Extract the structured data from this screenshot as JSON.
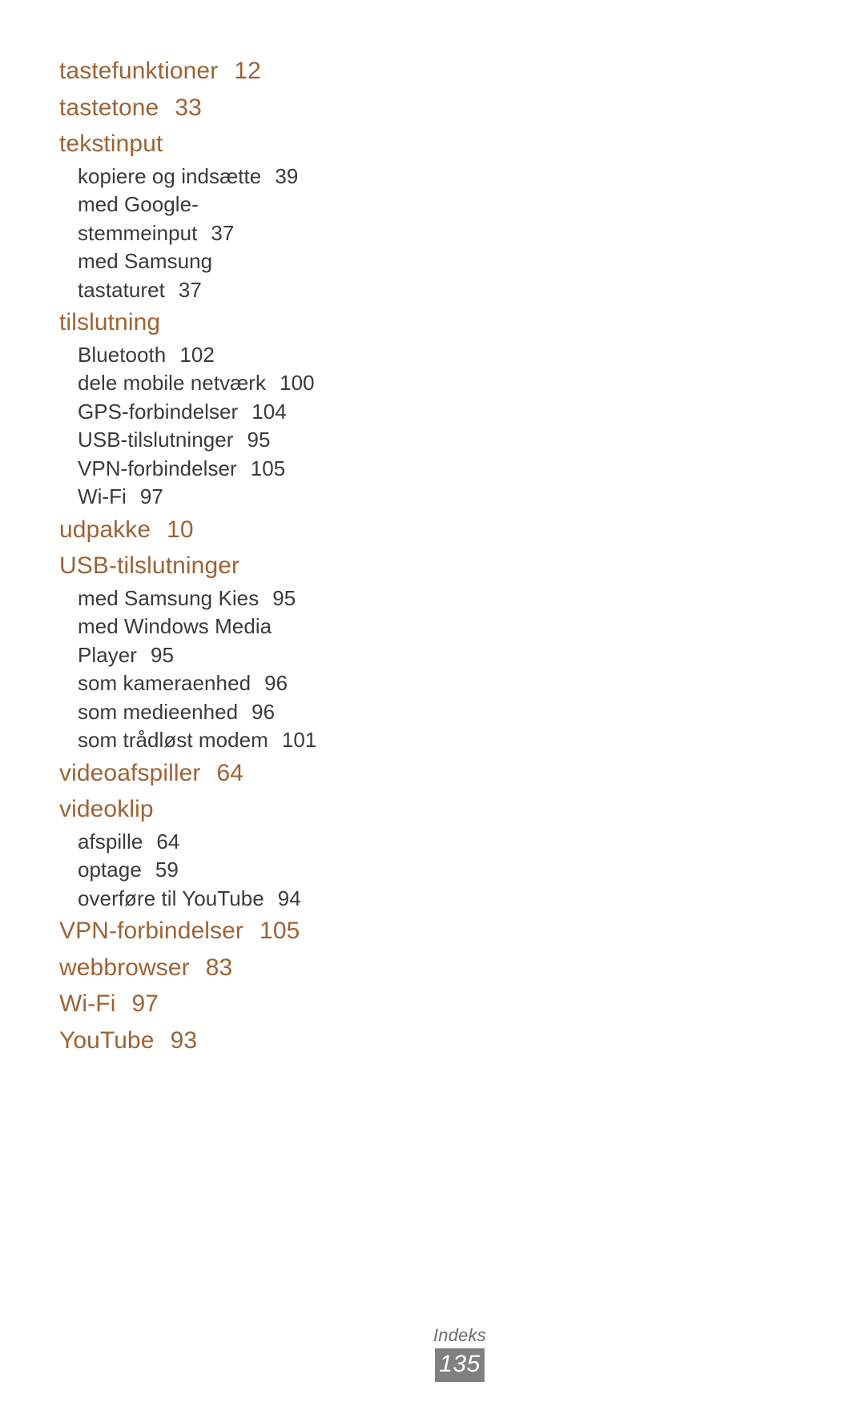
{
  "document": {
    "type": "index-page",
    "language": "da"
  },
  "colors": {
    "heading": "#9D6336",
    "subentry": "#3A3A3A",
    "footer_label": "#6B6B6B",
    "footer_pageno_background": "#808080",
    "footer_pageno_text": "#FFFFFF",
    "page_background": "#FFFFFF"
  },
  "index": {
    "entries": [
      {
        "label": "tastefunktioner",
        "page": "12",
        "subentries": []
      },
      {
        "label": "tastetone",
        "page": "33",
        "subentries": []
      },
      {
        "label": "tekstinput",
        "page": "",
        "subentries": [
          {
            "lines": [
              "kopiere og indsætte"
            ],
            "page": "39"
          },
          {
            "lines": [
              "med Google-",
              "stemmeinput"
            ],
            "page": "37"
          },
          {
            "lines": [
              "med Samsung",
              "tastaturet"
            ],
            "page": "37"
          }
        ]
      },
      {
        "label": "tilslutning",
        "page": "",
        "subentries": [
          {
            "lines": [
              "Bluetooth"
            ],
            "page": "102"
          },
          {
            "lines": [
              "dele mobile netværk"
            ],
            "page": "100"
          },
          {
            "lines": [
              "GPS-forbindelser"
            ],
            "page": "104"
          },
          {
            "lines": [
              "USB-tilslutninger"
            ],
            "page": "95"
          },
          {
            "lines": [
              "VPN-forbindelser"
            ],
            "page": "105"
          },
          {
            "lines": [
              "Wi-Fi"
            ],
            "page": "97"
          }
        ]
      },
      {
        "label": "udpakke",
        "page": "10",
        "subentries": []
      },
      {
        "label": "USB-tilslutninger",
        "page": "",
        "subentries": [
          {
            "lines": [
              "med Samsung Kies"
            ],
            "page": "95"
          },
          {
            "lines": [
              "med Windows Media",
              "Player"
            ],
            "page": "95"
          },
          {
            "lines": [
              "som kameraenhed"
            ],
            "page": "96"
          },
          {
            "lines": [
              "som medieenhed"
            ],
            "page": "96"
          },
          {
            "lines": [
              "som trådløst modem"
            ],
            "page": "101"
          }
        ]
      },
      {
        "label": "videoafspiller",
        "page": "64",
        "subentries": []
      },
      {
        "label": "videoklip",
        "page": "",
        "subentries": [
          {
            "lines": [
              "afspille"
            ],
            "page": "64"
          },
          {
            "lines": [
              "optage"
            ],
            "page": "59"
          },
          {
            "lines": [
              "overføre til YouTube"
            ],
            "page": "94"
          }
        ]
      },
      {
        "label": "VPN-forbindelser",
        "page": "105",
        "subentries": []
      },
      {
        "label": "webbrowser",
        "page": "83",
        "subentries": []
      },
      {
        "label": "Wi-Fi",
        "page": "97",
        "subentries": []
      },
      {
        "label": "YouTube",
        "page": "93",
        "subentries": []
      }
    ]
  },
  "footer": {
    "label": "Indeks",
    "page_number": "135"
  }
}
